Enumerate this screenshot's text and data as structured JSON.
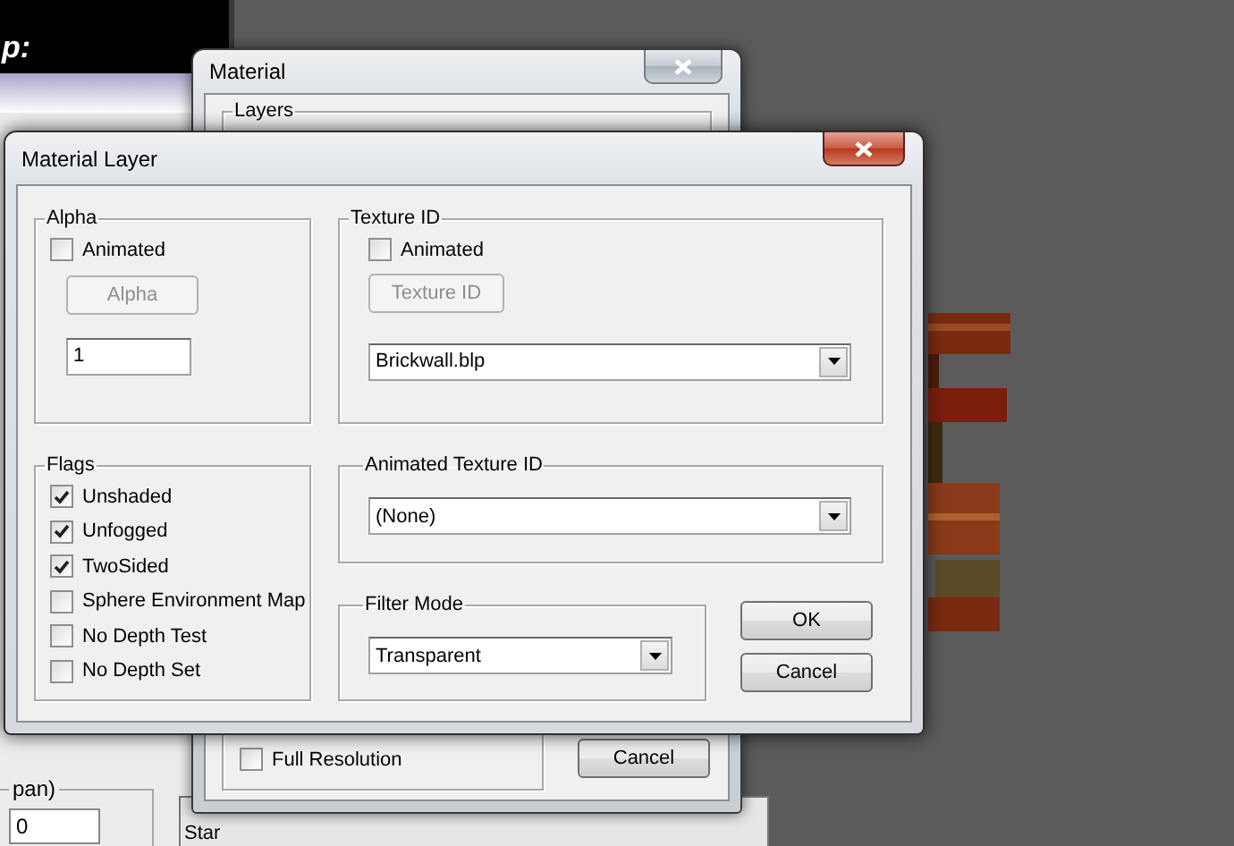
{
  "desktop_left_window": {
    "header_text": "p:",
    "group_label": "pan)",
    "field_value": "0"
  },
  "lower_window": {
    "label": "Star"
  },
  "material_window": {
    "title": "Material",
    "layers_group": {
      "label": "Layers"
    },
    "full_resolution": {
      "label": "Full Resolution",
      "checked": false
    },
    "cancel_button": {
      "label": "Cancel",
      "disabled": false
    }
  },
  "material_layer_dialog": {
    "title": "Material Layer",
    "alpha": {
      "label": "Alpha",
      "animated": {
        "label": "Animated",
        "checked": false
      },
      "button": {
        "label": "Alpha",
        "disabled": true
      },
      "value": "1"
    },
    "texture_id": {
      "label": "Texture ID",
      "animated": {
        "label": "Animated",
        "checked": false
      },
      "button": {
        "label": "Texture ID",
        "disabled": true
      },
      "selected_texture": "Brickwall.blp"
    },
    "flags": {
      "label": "Flags",
      "items": [
        {
          "label": "Unshaded",
          "checked": true
        },
        {
          "label": "Unfogged",
          "checked": true
        },
        {
          "label": "TwoSided",
          "checked": true
        },
        {
          "label": "Sphere Environment Map",
          "checked": false
        },
        {
          "label": "No Depth Test",
          "checked": false
        },
        {
          "label": "No Depth Set",
          "checked": false
        }
      ]
    },
    "animated_texture_id": {
      "label": "Animated Texture ID",
      "value": "(None)"
    },
    "filter_mode": {
      "label": "Filter Mode",
      "value": "Transparent"
    },
    "buttons": [
      {
        "label": "OK",
        "disabled": false
      },
      {
        "label": "Cancel",
        "disabled": false
      }
    ]
  }
}
